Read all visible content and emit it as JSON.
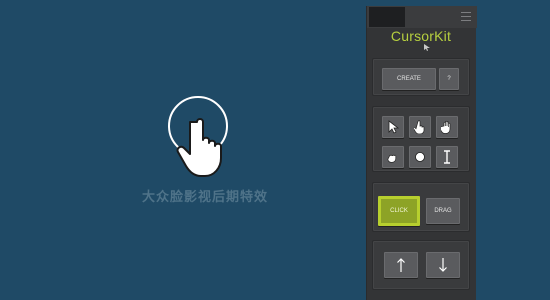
{
  "canvas": {
    "watermark_text": "大众脸影视后期特效",
    "preview_icon": "hand-pointer-circle-icon"
  },
  "panel": {
    "logo_text": "CursorKit",
    "menu_icon": "hamburger-menu-icon",
    "create_label": "CREATE",
    "help_label": "?",
    "tools": [
      {
        "icon": "arrow-cursor-icon"
      },
      {
        "icon": "pointer-hand-icon"
      },
      {
        "icon": "open-hand-icon"
      },
      {
        "icon": "grab-hand-icon"
      },
      {
        "icon": "dot-cursor-icon"
      },
      {
        "icon": "text-ibeam-icon"
      }
    ],
    "click_label": "CLICK",
    "drag_label": "DRAG",
    "up_icon": "arrow-up-icon",
    "down_icon": "arrow-down-icon"
  },
  "colors": {
    "background": "#1f4a66",
    "panel": "#333436",
    "accent": "#b7cf2e"
  }
}
